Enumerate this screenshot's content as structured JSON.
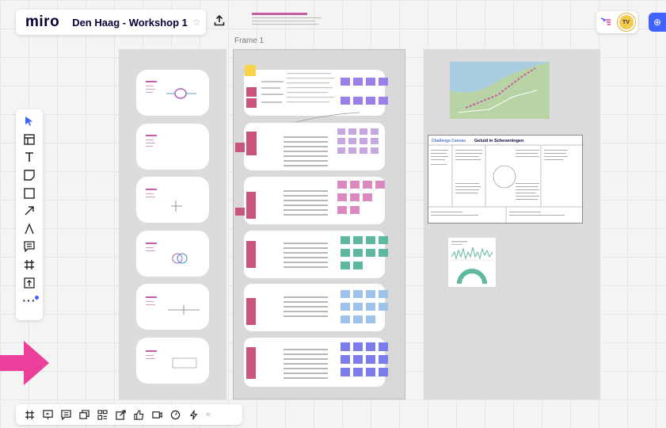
{
  "app": {
    "logo": "miro",
    "board_title": "Den Haag - Workshop 1"
  },
  "icons": {
    "star": "star-icon",
    "export": "upload-icon",
    "reaction": "reaction-icon",
    "share": "globe-icon"
  },
  "user": {
    "initials": "TV"
  },
  "frame": {
    "label": "Frame 1"
  },
  "left_toolbar": [
    {
      "name": "select-tool",
      "icon": "cursor-icon"
    },
    {
      "name": "templates-tool",
      "icon": "layout-icon"
    },
    {
      "name": "text-tool",
      "icon": "text-icon"
    },
    {
      "name": "sticky-note-tool",
      "icon": "sticky-note-icon"
    },
    {
      "name": "shape-tool",
      "icon": "rectangle-icon"
    },
    {
      "name": "connection-line-tool",
      "icon": "arrow-icon"
    },
    {
      "name": "pen-tool",
      "icon": "pen-icon"
    },
    {
      "name": "comment-tool",
      "icon": "comment-icon"
    },
    {
      "name": "frame-tool",
      "icon": "frame-icon"
    },
    {
      "name": "upload-tool",
      "icon": "upload-icon"
    },
    {
      "name": "more-tools",
      "icon": "more-icon"
    }
  ],
  "bottom_toolbar": [
    "frames-icon",
    "presentation-icon",
    "comments-icon",
    "cards-icon",
    "kanban-icon",
    "embed-icon",
    "voting-icon",
    "video-icon",
    "timer-icon",
    "apps-icon"
  ],
  "colors": {
    "accent": "#4262ff",
    "arrow": "#ec3f9b",
    "sticky_purple": "#9b7fe8",
    "sticky_pink": "#c9557a"
  },
  "canvas": {
    "challenge_card": {
      "title": "Challenge Canvas",
      "subtitle": "Geluid in Scheveningen"
    }
  }
}
